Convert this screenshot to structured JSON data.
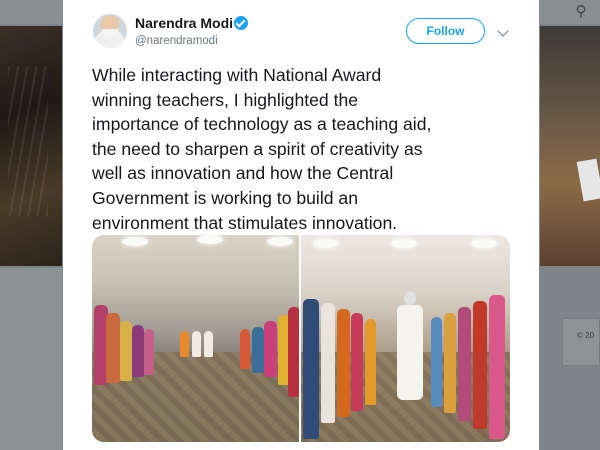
{
  "background": {
    "search_icon": "search-icon",
    "right_box_text": "© 20"
  },
  "tweet": {
    "author_name": "Narendra Modi",
    "author_handle": "@narendramodi",
    "verified_icon": "verified-badge-icon",
    "follow_label": "Follow",
    "menu_icon": "chevron-down-icon",
    "text_lines": [
      "While interacting with National Award",
      "winning teachers, I highlighted the",
      "importance of technology as a teaching aid,",
      "the need to sharpen a spirit of creativity as",
      "well as innovation and how the Central",
      "Government is working to build an",
      "environment that stimulates innovation."
    ],
    "photos": [
      "photo-meeting-room",
      "photo-greeting-teachers"
    ]
  },
  "colors": {
    "accent": "#1da1f2",
    "text": "#14171a",
    "muted": "#657786",
    "overlay": "#7f8588"
  }
}
